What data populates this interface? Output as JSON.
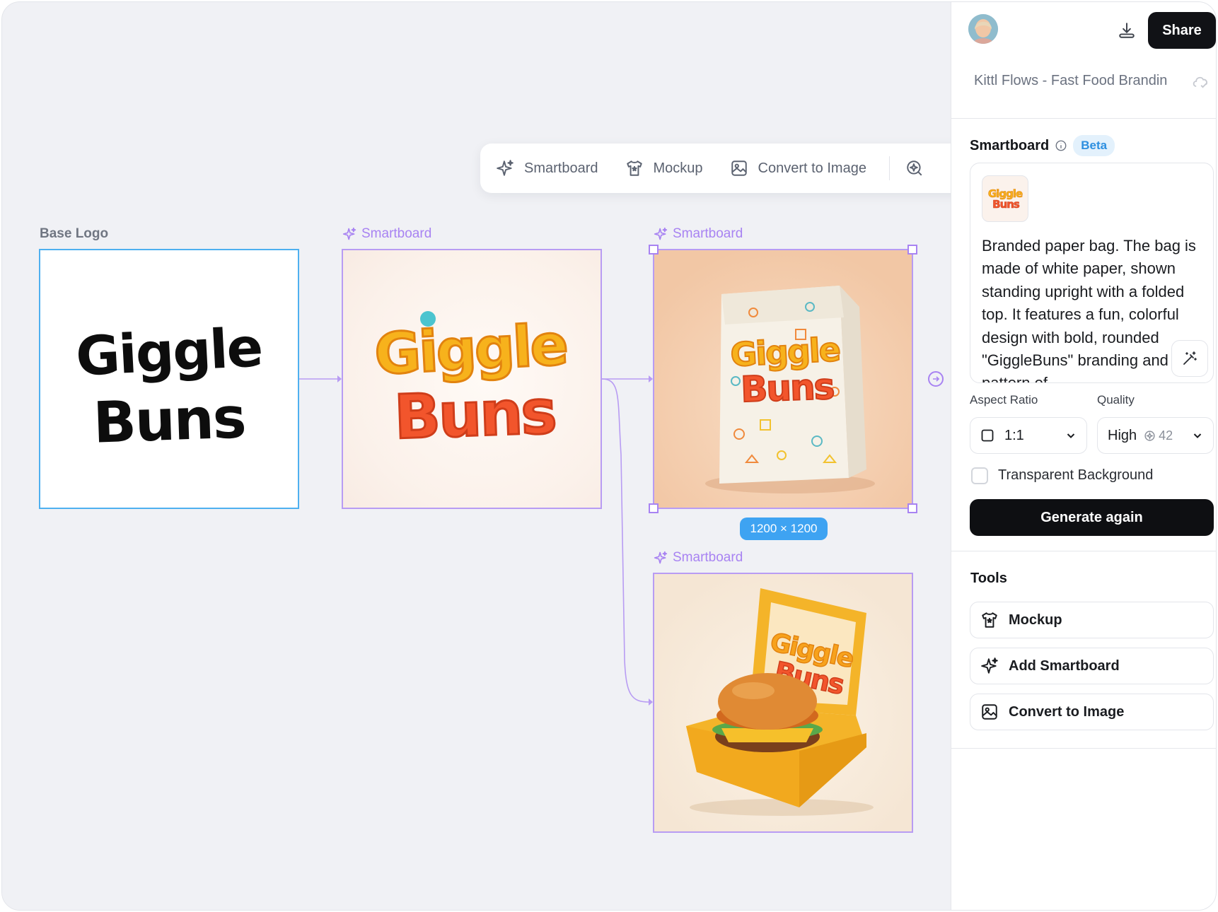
{
  "toolbar": {
    "items": [
      {
        "label": "Smartboard",
        "icon": "sparkle-icon"
      },
      {
        "label": "Mockup",
        "icon": "tshirt-icon"
      },
      {
        "label": "Convert to Image",
        "icon": "image-icon"
      }
    ],
    "extra_icon": "ai-search-icon"
  },
  "canvas": {
    "nodes": [
      {
        "label": "Base Logo",
        "type": "base",
        "art_text": [
          "Giggle",
          "Buns"
        ]
      },
      {
        "label": "Smartboard",
        "type": "smartboard",
        "art_text": [
          "Giggle",
          "Buns"
        ]
      },
      {
        "label": "Smartboard",
        "type": "smartboard",
        "art_text": [
          "Giggle",
          "Buns"
        ]
      },
      {
        "label": "Smartboard",
        "type": "smartboard",
        "art_text": [
          "Giggle",
          "Buns"
        ]
      }
    ],
    "selected_size": "1200 × 1200"
  },
  "panel": {
    "file_title": "Kittl Flows - Fast Food Brandin",
    "share_label": "Share",
    "smartboard": {
      "title": "Smartboard",
      "badge": "Beta",
      "prompt": "Branded paper bag. The bag is made of white paper, shown standing upright with a folded top. It features a fun, colorful design with bold, rounded \"GiggleBuns\" branding and a pattern of"
    },
    "aspect_ratio": {
      "label": "Aspect Ratio",
      "value": "1:1"
    },
    "quality": {
      "label": "Quality",
      "value": "High",
      "credits": "42"
    },
    "transparent_bg": {
      "label": "Transparent Background",
      "checked": false
    },
    "generate_label": "Generate again",
    "tools": {
      "title": "Tools",
      "items": [
        {
          "label": "Mockup",
          "icon": "tshirt-icon"
        },
        {
          "label": "Add Smartboard",
          "icon": "sparkle-icon"
        },
        {
          "label": "Convert to Image",
          "icon": "image-icon"
        }
      ]
    }
  },
  "colors": {
    "accent_purple": "#a883f2",
    "selection_blue": "#3ea3f2",
    "beta_blue": "#2d8fe0",
    "button_dark": "#111216"
  }
}
